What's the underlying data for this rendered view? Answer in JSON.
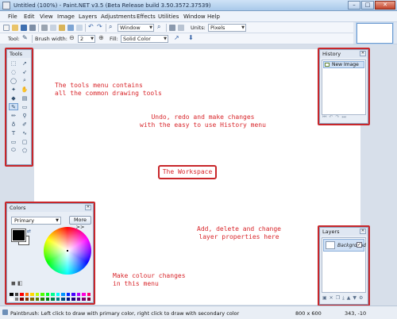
{
  "window": {
    "title": "Untitled (100%) - Paint.NET v3.5 (Beta Release build 3.50.3572.37539)",
    "min": "–",
    "max": "□",
    "close": "✕"
  },
  "menu": [
    "File",
    "Edit",
    "View",
    "Image",
    "Layers",
    "Adjustments",
    "Effects",
    "Utilities",
    "Window",
    "Help"
  ],
  "toolbar": {
    "window_combo": "Window",
    "units_label": "Units:",
    "units_value": "Pixels",
    "tool_label": "Tool:",
    "brush_width_label": "Brush width:",
    "brush_width_value": "2",
    "fill_label": "Fill:",
    "fill_value": "Solid Color"
  },
  "tools_panel": {
    "title": "Tools"
  },
  "history_panel": {
    "title": "History",
    "items": [
      "New Image"
    ]
  },
  "colors_panel": {
    "title": "Colors",
    "mode": "Primary",
    "more_button": "More >>"
  },
  "layers_panel": {
    "title": "Layers",
    "layers": [
      {
        "name": "Background",
        "visible": true
      }
    ]
  },
  "annotations": {
    "tools": "The tools menu contains\nall the common drawing tools",
    "history": "Undo, redo and make changes\nwith the easy to use History menu",
    "workspace": "The Workspace",
    "layers": "Add, delete and change\nlayer properties here",
    "colors": "Make colour changes\nin this menu"
  },
  "status": {
    "text": "Paintbrush: Left click to draw with primary color, right click to draw with secondary color",
    "image_size": "800 x 600",
    "cursor_pos": "343, -10"
  },
  "colors": {
    "annotation_red": "#d8262b",
    "selection_blue": "#cfe0f5",
    "panel_bg": "#e8eef6"
  }
}
